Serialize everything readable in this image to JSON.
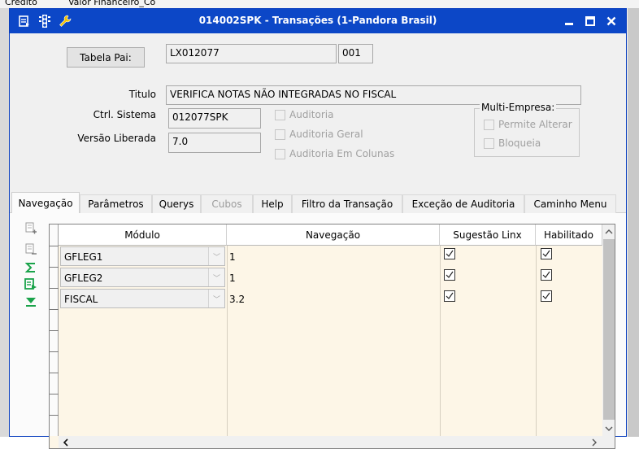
{
  "background_app": {
    "headers": [
      "Crédito",
      "Valor Financeiro_Co"
    ]
  },
  "window": {
    "title": "014002SPK - Transações (1-Pandora Brasil)",
    "title_icons": [
      "list-icon",
      "traffic-light-icon",
      "wrench-icon"
    ],
    "controls": {
      "minimize": "—",
      "maximize": "□",
      "close": "X"
    }
  },
  "form": {
    "tabela_pai_button": "Tabela Pai:",
    "tabela_pai_value": "LX012077",
    "tabela_pai_seq": "001",
    "titulo_label": "Titulo",
    "titulo_value": "VERIFICA NOTAS NÃO INTEGRADAS NO FISCAL",
    "ctrl_sistema_label": "Ctrl. Sistema",
    "ctrl_sistema_value": "012077SPK",
    "versao_label": "Versão Liberada",
    "versao_value": "7.0",
    "auditoria": "Auditoria",
    "auditoria_geral": "Auditoria Geral",
    "auditoria_colunas": "Auditoria Em Colunas",
    "multi_empresa": {
      "title": "Multi-Empresa:",
      "permite_alterar": "Permite Alterar",
      "bloqueia": "Bloqueia"
    }
  },
  "tabs": [
    {
      "label": "Navegação",
      "active": true
    },
    {
      "label": "Parâmetros"
    },
    {
      "label": "Querys"
    },
    {
      "label": "Cubos",
      "disabled": true
    },
    {
      "label": "Help"
    },
    {
      "label": "Filtro da Transação"
    },
    {
      "label": "Exceção de Auditoria"
    },
    {
      "label": "Caminho Menu"
    }
  ],
  "side_tools": [
    "add-row-icon",
    "remove-row-icon",
    "sum-icon",
    "export-icon",
    "filter-icon"
  ],
  "grid": {
    "columns": [
      "Módulo",
      "Navegação",
      "Sugestão Linx",
      "Habilitado"
    ],
    "rows": [
      {
        "modulo": "GFLEG1",
        "navegacao": "1",
        "sugestao": true,
        "habilitado": true
      },
      {
        "modulo": "GFLEG2",
        "navegacao": "1",
        "sugestao": true,
        "habilitado": true
      },
      {
        "modulo": "FISCAL",
        "navegacao": "3.2",
        "sugestao": true,
        "habilitado": true
      }
    ]
  },
  "colors": {
    "titlebar": "#0c47c7",
    "grid_background": "#fdf6e7",
    "sum_icon": "#1aa34a"
  }
}
